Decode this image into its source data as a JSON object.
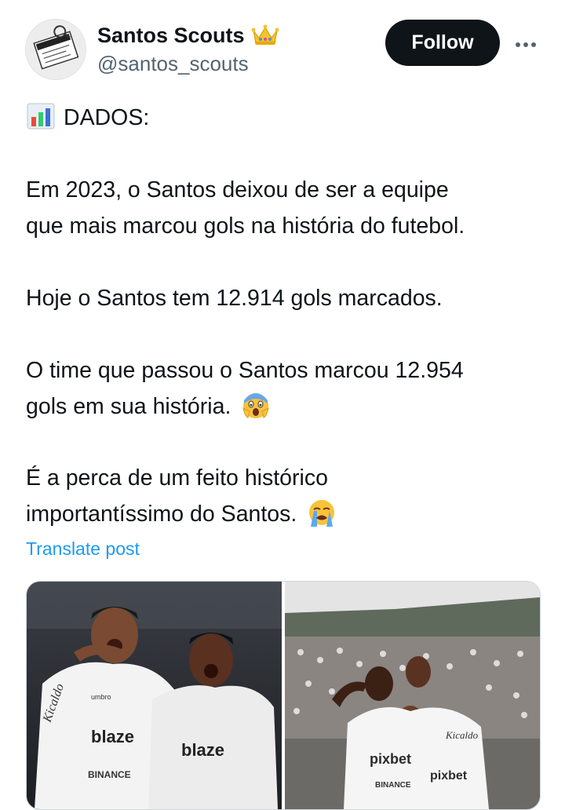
{
  "author": {
    "display_name": "Santos Scouts",
    "handle": "@santos_scouts",
    "badge_icon": "crown-icon",
    "avatar_icon": "santos-scouts-avatar"
  },
  "actions": {
    "follow_label": "Follow",
    "more_icon": "more-dots-icon"
  },
  "post": {
    "lines": [
      {
        "text": "DADOS:",
        "emoji_before": "bar-chart-emoji"
      },
      {
        "text": "Em 2023, o Santos deixou de ser a equipe"
      },
      {
        "text": "que mais marcou gols na história do futebol."
      },
      {
        "text": "Hoje o Santos tem 12.914 gols marcados."
      },
      {
        "text": "O time que passou o Santos marcou 12.954"
      },
      {
        "text": "gols em sua história.",
        "emoji_after": "screaming-face-emoji"
      },
      {
        "text": "É a perca de um feito histórico"
      },
      {
        "text": "importantíssimo do Santos.",
        "emoji_after": "loudly-crying-face-emoji"
      }
    ],
    "translate_label": "Translate post"
  },
  "media": {
    "photos": [
      {
        "name": "photo-players-celebrating-night",
        "visible_text": [
          "Kicaldo",
          "blaze",
          "BINANCE",
          "umbro"
        ]
      },
      {
        "name": "photo-players-celebrating-stadium",
        "visible_text": [
          "pixbet",
          "BINANCE",
          "Kicaldo"
        ]
      }
    ]
  },
  "colors": {
    "text": "#0f1419",
    "secondary": "#536471",
    "link": "#1d9bf0",
    "follow_bg": "#0f1419",
    "follow_text": "#ffffff"
  }
}
